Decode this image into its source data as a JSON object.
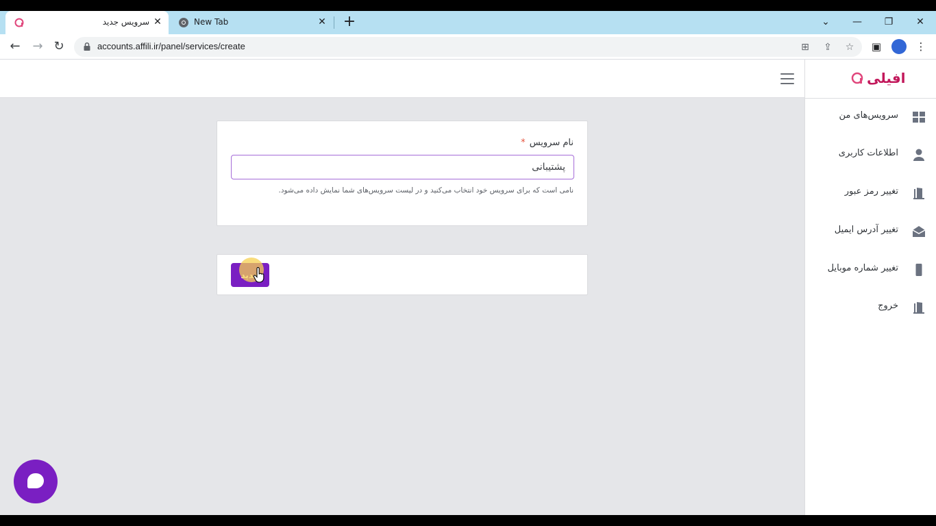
{
  "browser": {
    "tabs": [
      {
        "title": "سرویس جدید",
        "active": true
      },
      {
        "title": "New Tab",
        "active": false
      }
    ],
    "url": "accounts.affili.ir/panel/services/create",
    "accent_color": "#b6e0f2"
  },
  "app": {
    "logo_text": "افیلی",
    "brand_color": "#7a1fc2",
    "sidebar": {
      "items": [
        {
          "label": "سرویس‌های من",
          "icon": "grid-icon"
        },
        {
          "label": "اطلاعات کاربری",
          "icon": "user-icon"
        },
        {
          "label": "تغییر رمز عبور",
          "icon": "door-icon"
        },
        {
          "label": "تغییر آدرس ایمیل",
          "icon": "envelope-icon"
        },
        {
          "label": "تغییر شماره موبایل",
          "icon": "mobile-icon"
        },
        {
          "label": "خروج",
          "icon": "logout-door-icon"
        }
      ]
    },
    "form": {
      "service_name_label": "نام سرویس",
      "required_mark": "*",
      "service_name_value": "پشتیبانی",
      "help_text": "نامی است که برای سرویس خود انتخاب می‌کنید و در لیست سرویس‌های شما نمایش داده می‌شود.",
      "submit_label": "جدید"
    }
  }
}
